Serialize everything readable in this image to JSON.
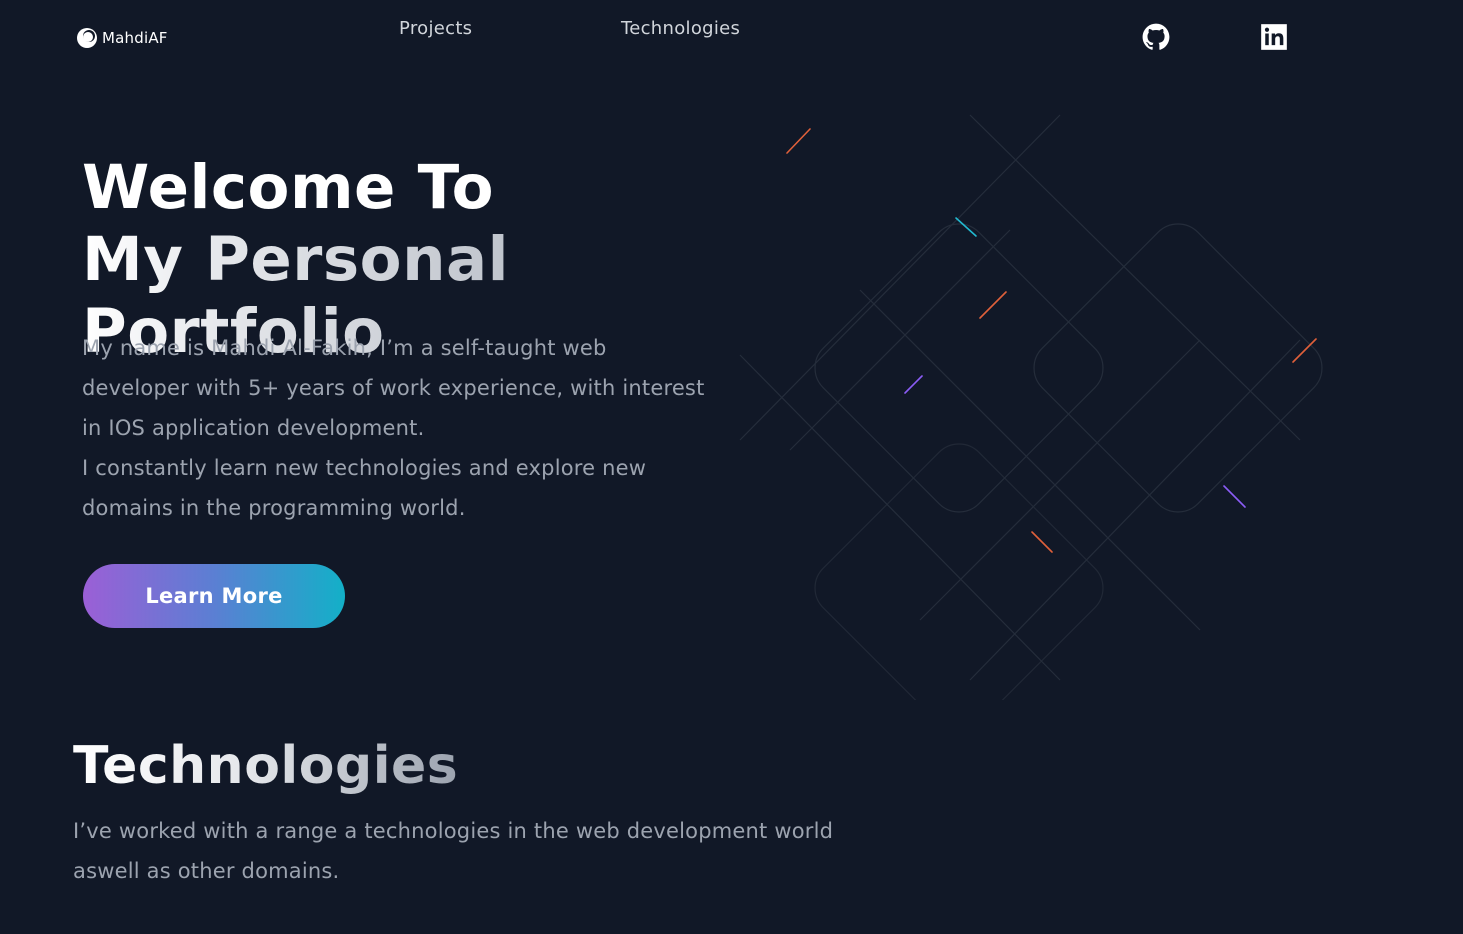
{
  "header": {
    "logo_text": "MahdiAF",
    "nav": [
      {
        "label": "Projects"
      },
      {
        "label": "Technologies"
      }
    ],
    "social": [
      {
        "icon": "github-icon"
      },
      {
        "icon": "linkedin-icon"
      }
    ]
  },
  "hero": {
    "title_line1": "Welcome To",
    "title_line2": "My Personal Portfolio",
    "description": [
      "My name is Mahdi Al-Fakih, I’m a self-taught web",
      "developer with 5+ years of work experience, with interest",
      "in IOS application development.",
      "I constantly learn new technologies and explore new",
      "domains in the programming world."
    ],
    "cta_label": "Learn More"
  },
  "technologies": {
    "title": "Technologies",
    "description": "I’ve worked with a range a technologies in the web development world aswell as other domains."
  },
  "colors": {
    "background": "#111827",
    "text_muted": "#9ca3af",
    "button_gradient_start": "#9b5fd6",
    "button_gradient_end": "#13b0c8"
  }
}
